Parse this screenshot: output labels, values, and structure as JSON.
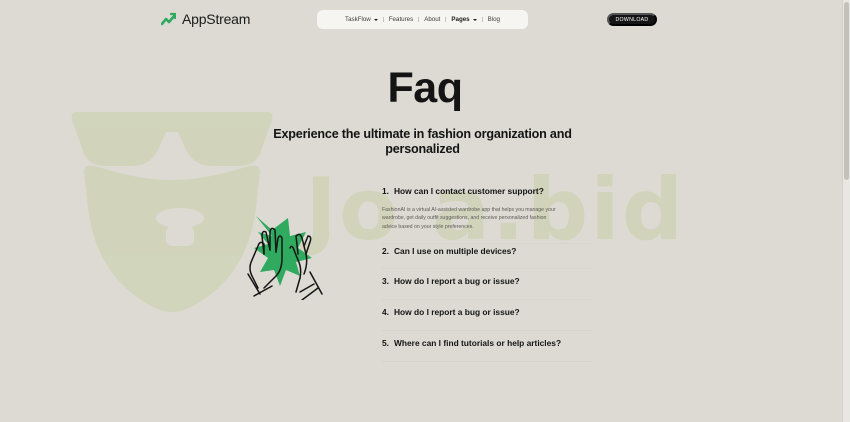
{
  "brand": {
    "name": "AppStream",
    "accent": "#2faa5e"
  },
  "nav": {
    "items": [
      {
        "label": "TaskFlow",
        "dropdown": true,
        "bold": false
      },
      {
        "label": "Features",
        "dropdown": false,
        "bold": false
      },
      {
        "label": "About",
        "dropdown": false,
        "bold": false
      },
      {
        "label": "Pages",
        "dropdown": true,
        "bold": true
      },
      {
        "label": "Blog",
        "dropdown": false,
        "bold": false
      }
    ],
    "download_label": "DOWNLOAD"
  },
  "hero": {
    "title": "Faq",
    "subtitle": "Experience the ultimate in fashion organization and personalized"
  },
  "faq": {
    "items": [
      {
        "number": "1.",
        "question": "How can I contact customer support?",
        "answer": "FashionAI is a virtual AI-assisted wardrobe app that helps you manage your wardrobe, get daily outfit suggestions, and receive personalized fashion advice based on your style preferences.",
        "expanded": true
      },
      {
        "number": "2.",
        "question": "Can I use on multiple devices?",
        "expanded": false
      },
      {
        "number": "3.",
        "question": "How do I report a bug or issue?",
        "expanded": false
      },
      {
        "number": "4.",
        "question": "How do I report a bug or issue?",
        "expanded": false
      },
      {
        "number": "5.",
        "question": "Where can I find tutorials or help articles?",
        "expanded": false
      }
    ]
  },
  "watermark": {
    "text": "Jo    a.bid"
  },
  "colors": {
    "background": "#dddad3",
    "text": "#141414",
    "button": "#141414",
    "nav_bg": "#f6f5f2",
    "watermark": "#cfd3b7"
  },
  "icons": [
    "logo-mark-icon",
    "chevron-down-icon",
    "high-five-hands-icon",
    "starburst-icon"
  ]
}
